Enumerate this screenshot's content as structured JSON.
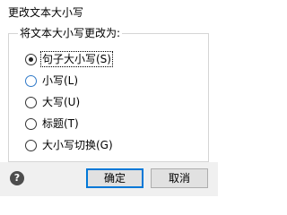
{
  "dialog": {
    "title": "更改文本大小写",
    "group_label": "将文本大小写更改为:",
    "options": [
      {
        "label": "句子大小写(S)",
        "checked": true
      },
      {
        "label": "小写(L)",
        "checked": false
      },
      {
        "label": "大写(U)",
        "checked": false
      },
      {
        "label": "标题(T)",
        "checked": false
      },
      {
        "label": "大小写切换(G)",
        "checked": false
      }
    ],
    "help_icon": "question-icon",
    "help_glyph": "?",
    "ok_label": "确定",
    "cancel_label": "取消"
  },
  "colors": {
    "accent": "#0078d7",
    "footer_bg": "#f0f0f0",
    "hover_radio": "#2f79c8"
  }
}
